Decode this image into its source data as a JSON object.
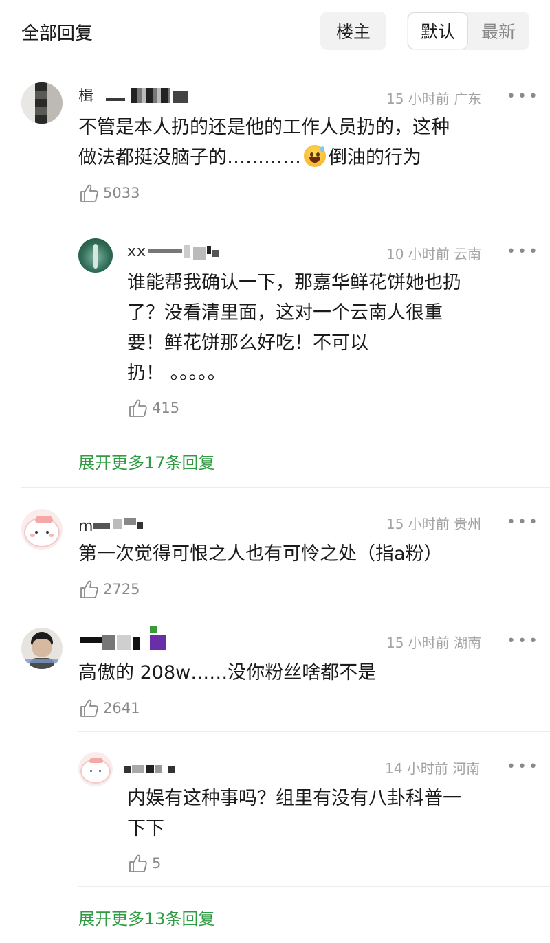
{
  "header": {
    "title": "全部回复",
    "owner_label": "楼主",
    "sort_default": "默认",
    "sort_latest": "最新"
  },
  "icons": {
    "like": "thumb-up-icon",
    "more": "more-horizontal-icon"
  },
  "colors": {
    "link_green": "#2f9c43",
    "meta_grey": "#a3a3a3"
  },
  "comments": [
    {
      "username_visible": "楫",
      "time": "15 小时前",
      "location": "广东",
      "more": "•••",
      "text_line1": "不管是本人扔的还是他的工作人员扔的，这种",
      "text_line2_a": "做法都挺没脑子的…………",
      "text_line2_b": "倒油的行为",
      "emoji": "sweat-smile-emoji",
      "likes": "5033",
      "replies": [
        {
          "username_visible": "xx",
          "time": "10 小时前",
          "location": "云南",
          "more": "•••",
          "text": [
            "谁能帮我确认一下，那嘉华鲜花饼她也扔",
            "了？没看清里面，这对一个云南人很重",
            "要！鲜花饼那么好吃！不可以",
            "扔！ 。。。。。"
          ],
          "likes": "415"
        }
      ],
      "expand": "展开更多17条回复"
    },
    {
      "username_visible": "m",
      "time": "15 小时前",
      "location": "贵州",
      "more": "•••",
      "text": "第一次觉得可恨之人也有可怜之处（指a粉）",
      "likes": "2725"
    },
    {
      "username_visible": "",
      "time": "15 小时前",
      "location": "湖南",
      "more": "•••",
      "text": "高傲的 208w……没你粉丝啥都不是",
      "likes": "2641",
      "replies": [
        {
          "username_visible": "",
          "time": "14 小时前",
          "location": "河南",
          "more": "•••",
          "text": [
            "内娱有这种事吗？组里有没有八卦科普一",
            "下下"
          ],
          "likes": "5"
        }
      ],
      "expand": "展开更多13条回复"
    }
  ]
}
